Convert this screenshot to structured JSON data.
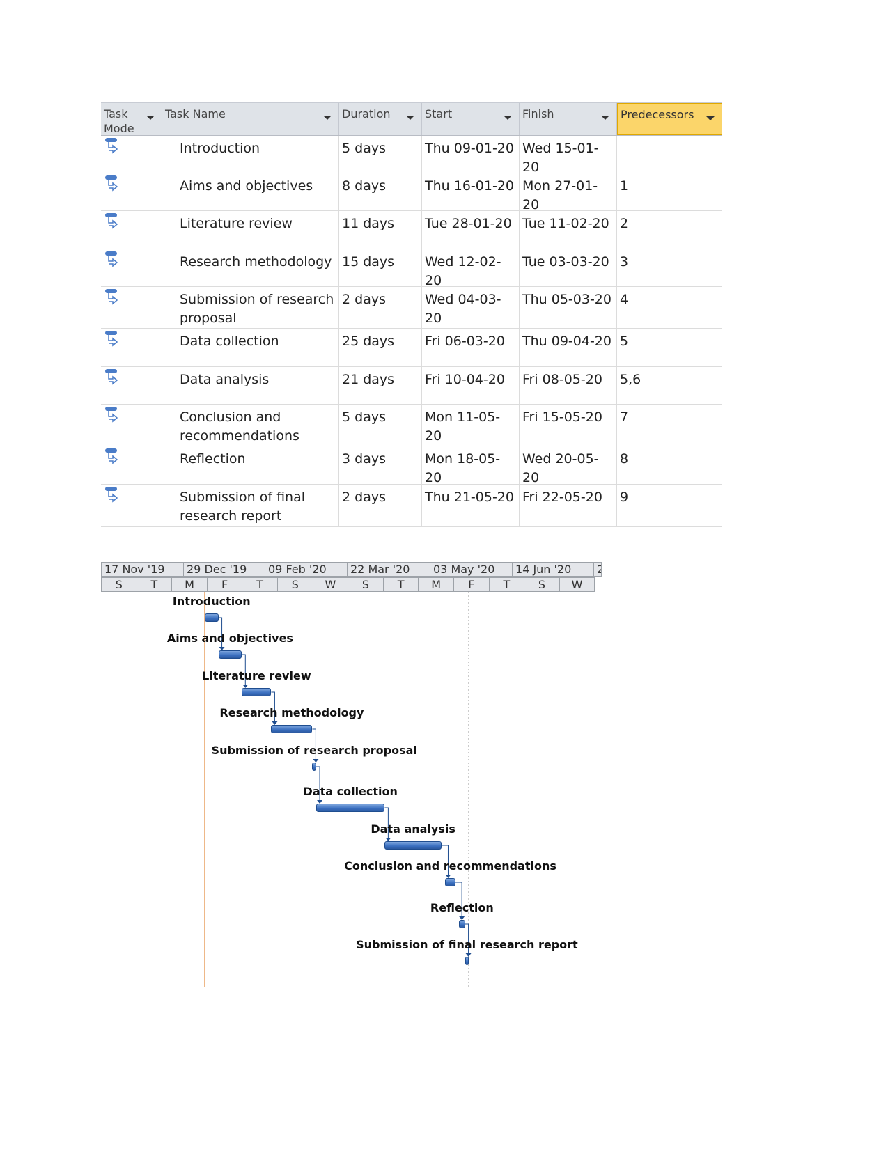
{
  "table": {
    "columns": [
      "Task\nMode",
      "Task Name",
      "Duration",
      "Start",
      "Finish",
      "Predecessors"
    ],
    "tasks": [
      {
        "name": "Introduction",
        "duration": "5 days",
        "start": "Thu 09-01-20",
        "finish": "Wed 15-01-20",
        "pred": ""
      },
      {
        "name": "Aims and objectives",
        "duration": "8 days",
        "start": "Thu 16-01-20",
        "finish": "Mon 27-01-20",
        "pred": "1"
      },
      {
        "name": "Literature review",
        "duration": "11 days",
        "start": "Tue 28-01-20",
        "finish": "Tue 11-02-20",
        "pred": "2"
      },
      {
        "name": "Research methodology",
        "duration": "15 days",
        "start": "Wed 12-02-20",
        "finish": "Tue 03-03-20",
        "pred": "3"
      },
      {
        "name": "Submission of research proposal",
        "duration": "2 days",
        "start": "Wed 04-03-20",
        "finish": "Thu 05-03-20",
        "pred": "4"
      },
      {
        "name": "Data collection",
        "duration": "25 days",
        "start": "Fri 06-03-20",
        "finish": "Thu 09-04-20",
        "pred": "5"
      },
      {
        "name": "Data analysis",
        "duration": "21 days",
        "start": "Fri 10-04-20",
        "finish": "Fri 08-05-20",
        "pred": "5,6"
      },
      {
        "name": "Conclusion and recommendations",
        "duration": "5 days",
        "start": "Mon 11-05-20",
        "finish": "Fri 15-05-20",
        "pred": "7"
      },
      {
        "name": "Reflection",
        "duration": "3 days",
        "start": "Mon 18-05-20",
        "finish": "Wed 20-05-20",
        "pred": "8"
      },
      {
        "name": "Submission of final research report",
        "duration": "2 days",
        "start": "Thu 21-05-20",
        "finish": "Fri 22-05-20",
        "pred": "9"
      }
    ]
  },
  "gantt": {
    "top_tier": [
      "17 Nov '19",
      "29 Dec '19",
      "09 Feb '20",
      "22 Mar '20",
      "03 May '20",
      "14 Jun '20",
      "2"
    ],
    "bottom_tier": [
      "S",
      "T",
      "M",
      "F",
      "T",
      "S",
      "W",
      "S",
      "T",
      "M",
      "F",
      "T",
      "S",
      "W"
    ],
    "bar_color": "#4a7cc8",
    "status_line_color": "#e8a060",
    "icon": "auto-scheduled-task-icon"
  }
}
